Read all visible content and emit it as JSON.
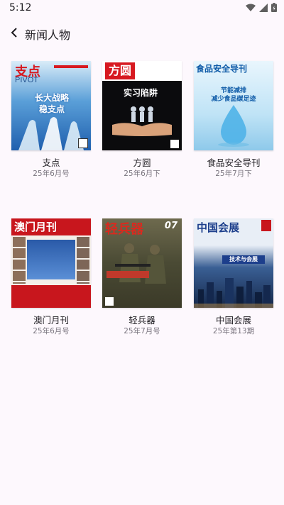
{
  "status": {
    "time": "5:12"
  },
  "header": {
    "title": "新闻人物"
  },
  "magazines": [
    {
      "name": "支点",
      "issue": "25年6月号",
      "cover_title": "支点",
      "cover_subtitle": "PIVOT",
      "cover_headline": "长大战略\n稳支点"
    },
    {
      "name": "方圆",
      "issue": "25年6月下",
      "cover_title": "方圆",
      "cover_headline": "实习陷阱"
    },
    {
      "name": "食品安全导刊",
      "issue": "25年7月下",
      "cover_title": "食品安全导刊",
      "cover_headline": "节能减排\n减少食品碳足迹"
    },
    {
      "name": "澳门月刊",
      "issue": "25年6月号",
      "cover_title": "澳门月刊"
    },
    {
      "name": "轻兵器",
      "issue": "25年7月号",
      "cover_title": "轻兵器",
      "cover_number": "07"
    },
    {
      "name": "中国会展",
      "issue": "25年第13期",
      "cover_title": "中国会展",
      "cover_headline": "技术与会展"
    }
  ],
  "colors": {
    "background": "#fdf8fd",
    "text": "#1d1b20",
    "secondary_text": "#7a757f"
  }
}
